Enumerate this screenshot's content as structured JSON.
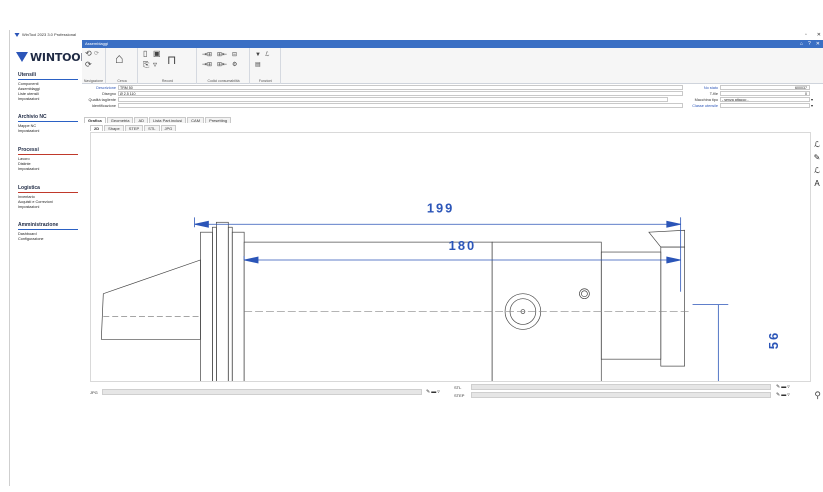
{
  "window": {
    "title": "WinTool 2023 3.0 Professional",
    "controls": [
      "▫",
      "✕"
    ]
  },
  "brand": {
    "name": "WINTOOL"
  },
  "sidebar": {
    "sections": [
      {
        "title": "Utensili",
        "items": [
          "Componenti",
          "Assemblaggi",
          "Liste utensili",
          "Impostazioni"
        ]
      },
      {
        "title": "Archivio NC",
        "items": [
          "Mappe NC",
          "Impostazioni"
        ]
      },
      {
        "title": "Processi",
        "items": [
          "Lavoro",
          "Distinte",
          "Impostazioni"
        ]
      },
      {
        "title": "Logistica",
        "items": [
          "Inventario",
          "Acquisti e Correzioni",
          "Impostazioni"
        ]
      },
      {
        "title": "Amministrazione",
        "items": [
          "Dashboard",
          "Configurazione"
        ]
      }
    ]
  },
  "ribbon": {
    "header": "Assemblaggi",
    "groups": [
      "Navigazione",
      "Cerca",
      "Record",
      "Codici consumabilità",
      "Funzioni"
    ]
  },
  "form": {
    "descrizione_label": "Descrizione",
    "descrizione_value": "TRM 50",
    "disegno_label": "Disegno",
    "disegno_value": "Ø 2.5 110",
    "qualita_label": "Qualità tagliente",
    "identificazione_label": "Identificazione",
    "no_stato_label": "No stato",
    "no_stato_value": "600037",
    "tfile_label": "T-file",
    "tfile_value": "0",
    "macchina_label": "Macchina tipo",
    "macchina_value": "- senza attacco -",
    "classe_label": "Classe utensile",
    "classe_value": ""
  },
  "tabs_main": [
    "Grafica",
    "Geometria",
    "AD",
    "Lista Part.inclusi",
    "CAM",
    "Presetting"
  ],
  "tabs_sub": [
    "2D",
    "Shape",
    "STEP",
    "STL",
    "JPG"
  ],
  "drawing": {
    "dim1": "199",
    "dim2": "180",
    "dim3": "56",
    "dim_color": "#2b55b8"
  },
  "bottom": {
    "jpg_label": "JPG",
    "stl_label": "STL",
    "step_label": "STEP"
  }
}
